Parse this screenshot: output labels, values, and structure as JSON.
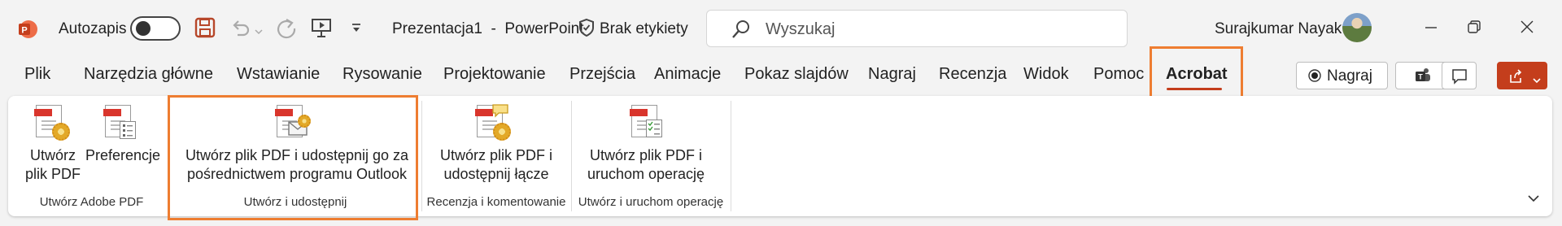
{
  "titlebar": {
    "app_logo": "powerpoint-logo",
    "autosave_label": "Autozapis",
    "autosave_on": false,
    "doc_title": "Prezentacja1  -  PowerPoint",
    "label_text": "Brak etykiety",
    "search_placeholder": "Wyszukaj",
    "user_name": "Surajkumar Nayak"
  },
  "tabs": [
    {
      "label": "Plik"
    },
    {
      "label": "Narzędzia główne"
    },
    {
      "label": "Wstawianie"
    },
    {
      "label": "Rysowanie"
    },
    {
      "label": "Projektowanie"
    },
    {
      "label": "Przejścia"
    },
    {
      "label": "Animacje"
    },
    {
      "label": "Pokaz slajdów"
    },
    {
      "label": "Nagraj"
    },
    {
      "label": "Recenzja"
    },
    {
      "label": "Widok"
    },
    {
      "label": "Pomoc"
    },
    {
      "label": "Acrobat",
      "active": true
    }
  ],
  "right_buttons": {
    "record_label": "Nagraj"
  },
  "ribbon": {
    "groups": [
      {
        "label": "Utwórz Adobe PDF",
        "buttons": [
          {
            "line1": "Utwórz",
            "line2": "plik PDF"
          },
          {
            "line1": "Preferencje",
            "line2": ""
          }
        ]
      },
      {
        "label": "Utwórz i udostępnij",
        "buttons": [
          {
            "line1": "Utwórz plik PDF i udostępnij go za",
            "line2": "pośrednictwem programu Outlook"
          }
        ]
      },
      {
        "label": "Recenzja i komentowanie",
        "buttons": [
          {
            "line1": "Utwórz plik PDF i",
            "line2": "udostępnij łącze"
          }
        ]
      },
      {
        "label": "Utwórz i uruchom operację",
        "buttons": [
          {
            "line1": "Utwórz plik PDF i",
            "line2": "uruchom operację"
          }
        ]
      }
    ]
  },
  "colors": {
    "accent": "#c43e1c",
    "highlight": "#ee7d31",
    "powerpoint": "#c43e1c",
    "save_icon": "#b7472a"
  }
}
